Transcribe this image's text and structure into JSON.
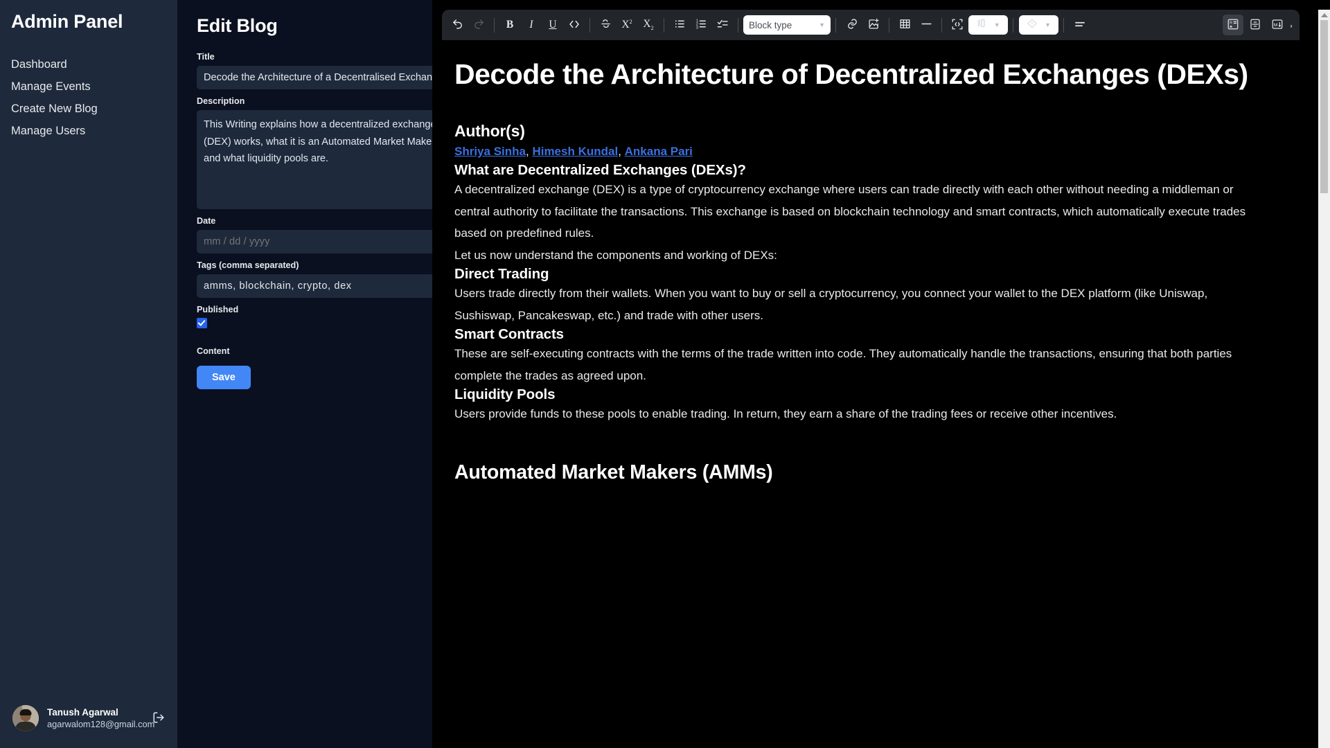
{
  "sidebar": {
    "title": "Admin Panel",
    "items": [
      {
        "label": "Dashboard",
        "name": "dashboard"
      },
      {
        "label": "Manage Events",
        "name": "manage-events"
      },
      {
        "label": "Create New Blog",
        "name": "create-new-blog"
      },
      {
        "label": "Manage Users",
        "name": "manage-users"
      }
    ],
    "user": {
      "name": "Tanush Agarwal",
      "email": "agarwalom128@gmail.com",
      "logout_icon": "logout-icon"
    }
  },
  "form": {
    "title": "Edit Blog",
    "fields": {
      "title_label": "Title",
      "title_value": "Decode the Architecture of a Decentralised Exchange (DEX)",
      "description_label": "Description",
      "description_value": "This Writing explains how a decentralized exchange (DEX) works, what it is an Automated Market Maker, and what liquidity pools are.",
      "date_label": "Date",
      "date_placeholder": "mm / dd / yyyy",
      "date_value": "",
      "tags_label": "Tags (comma separated)",
      "tags_value": "amms, blockchain, crypto, dex",
      "published_label": "Published",
      "published_checked": true,
      "content_label": "Content"
    },
    "save_label": "Save"
  },
  "toolbar": {
    "block_type_label": "Block type",
    "groups": [
      {
        "name": "undo",
        "icon": "undo-icon",
        "disabled": false
      },
      {
        "name": "redo",
        "icon": "redo-icon",
        "disabled": true
      },
      {
        "name": "sep"
      },
      {
        "name": "bold",
        "icon": "bold-icon",
        "glyph": "B"
      },
      {
        "name": "italic",
        "icon": "italic-icon",
        "glyph": "I"
      },
      {
        "name": "underline",
        "icon": "underline-icon",
        "glyph": "U"
      },
      {
        "name": "code",
        "icon": "code-icon",
        "glyph": "<>"
      },
      {
        "name": "sep"
      },
      {
        "name": "strikethrough",
        "icon": "strikethrough-icon"
      },
      {
        "name": "superscript",
        "icon": "superscript-icon"
      },
      {
        "name": "subscript",
        "icon": "subscript-icon"
      },
      {
        "name": "sep"
      },
      {
        "name": "bulleted-list",
        "icon": "bulleted-list-icon"
      },
      {
        "name": "numbered-list",
        "icon": "numbered-list-icon"
      },
      {
        "name": "checklist",
        "icon": "checklist-icon"
      },
      {
        "name": "sep"
      },
      {
        "name": "block-type",
        "icon": "block-type-select"
      },
      {
        "name": "sep"
      },
      {
        "name": "link",
        "icon": "link-icon"
      },
      {
        "name": "image",
        "icon": "insert-image-icon"
      },
      {
        "name": "sep"
      },
      {
        "name": "table",
        "icon": "table-icon"
      },
      {
        "name": "horizontal-rule",
        "icon": "horizontal-rule-icon"
      },
      {
        "name": "sep"
      },
      {
        "name": "code-block",
        "icon": "code-block-icon"
      },
      {
        "name": "columns",
        "icon": "columns-icon"
      },
      {
        "name": "sep"
      },
      {
        "name": "callout",
        "icon": "callout-icon"
      },
      {
        "name": "sep"
      },
      {
        "name": "align",
        "icon": "align-icon"
      }
    ],
    "right_buttons": [
      {
        "name": "rich-text-view",
        "icon": "rich-text-icon",
        "active": true
      },
      {
        "name": "split-view",
        "icon": "split-view-icon",
        "active": false
      },
      {
        "name": "markdown-view",
        "icon": "markdown-icon",
        "active": false
      }
    ],
    "overflow_glyph": ","
  },
  "document": {
    "heading": "Decode the Architecture of Decentralized Exchanges (DEXs)",
    "authors_heading": "Author(s)",
    "authors": [
      {
        "name": "Shriya Sinha"
      },
      {
        "name": "Himesh Kundal"
      },
      {
        "name": "Ankana Pari"
      }
    ],
    "authors_separator": ", ",
    "sections": [
      {
        "heading": "What are Decentralized Exchanges (DEXs)?",
        "level": 3,
        "paragraphs": [
          "A decentralized exchange (DEX) is a type of cryptocurrency exchange where users can trade directly with each other without needing a middleman or central authority to facilitate the transactions. This exchange is based on blockchain technology and smart contracts, which automatically execute trades based on predefined rules.",
          "Let us now understand the components and working of DEXs:"
        ]
      },
      {
        "heading": "Direct Trading",
        "level": 3,
        "paragraphs": [
          "Users trade directly from their wallets. When you want to buy or sell a cryptocurrency, you connect your wallet to the DEX platform (like Uniswap, Sushiswap, Pancakeswap, etc.) and trade with other users."
        ]
      },
      {
        "heading": "Smart Contracts",
        "level": 3,
        "paragraphs": [
          "These are self-executing contracts with the terms of the trade written into code. They automatically handle the transactions, ensuring that both parties complete the trades as agreed upon."
        ]
      },
      {
        "heading": "Liquidity Pools",
        "level": 3,
        "paragraphs": [
          "Users provide funds to these pools to enable trading. In return, they earn a share of the trading fees or receive other incentives."
        ]
      },
      {
        "heading": "Automated Market Makers (AMMs)",
        "level": 2,
        "paragraphs": []
      }
    ]
  },
  "colors": {
    "sidebar_bg": "#1e293b",
    "panel_bg": "#0a1020",
    "editor_bg": "#000000",
    "toolbar_bg": "#22262b",
    "accent": "#4287f5",
    "checkbox": "#2563eb",
    "link": "#3b6fe0",
    "input_bg": "#1e293b"
  }
}
